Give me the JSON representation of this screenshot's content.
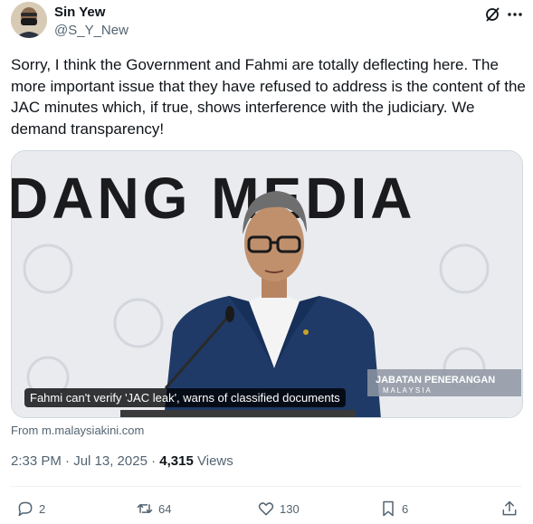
{
  "author": {
    "name": "Sin Yew",
    "handle": "@S_Y_New"
  },
  "tweet": {
    "text": "Sorry, I think the Government and Fahmi are totally deflecting here. The more important issue that they have refused to address is the content of the JAC minutes which, if true, shows interference with the judiciary. We demand transparency!"
  },
  "media": {
    "backdrop_text": "DANG MEDIA",
    "watermark_title": "JABATAN PENERANGAN",
    "watermark_subtitle": "M A L A Y S I A",
    "caption": "Fahmi can't verify 'JAC leak', warns of classified documents",
    "source": "From m.malaysiakini.com"
  },
  "meta": {
    "timestamp": "2:33 PM · Jul 13, 2025",
    "separator": " · ",
    "views_count": "4,315",
    "views_label": "Views"
  },
  "actions": {
    "replies": "2",
    "reposts": "64",
    "likes": "130",
    "bookmarks": "6"
  },
  "icons": [
    "grok-icon",
    "more-icon",
    "reply-icon",
    "repost-icon",
    "like-icon",
    "bookmark-icon",
    "share-icon"
  ],
  "colors": {
    "text": "#0f1419",
    "secondary": "#536471",
    "border": "#cfd9de",
    "suit": "#1f3a66"
  }
}
